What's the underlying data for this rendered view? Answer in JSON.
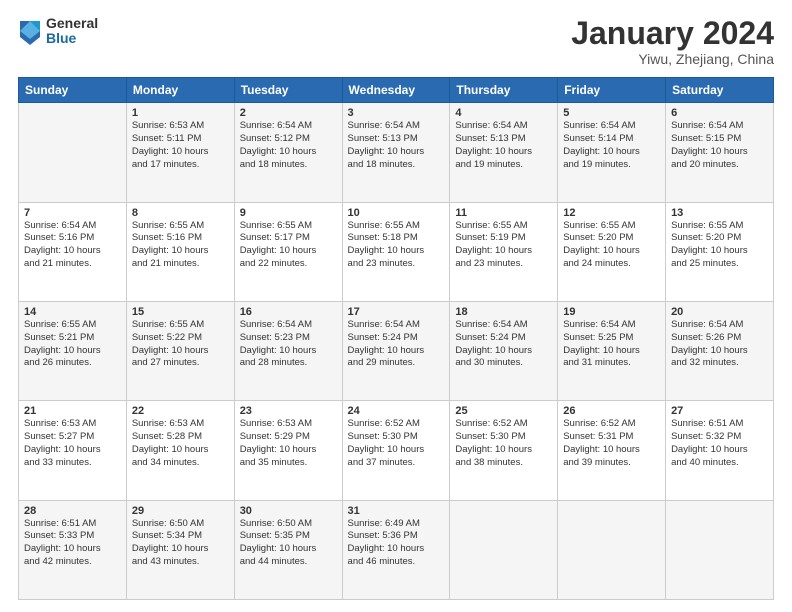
{
  "logo": {
    "general": "General",
    "blue": "Blue"
  },
  "header": {
    "month": "January 2024",
    "location": "Yiwu, Zhejiang, China"
  },
  "weekdays": [
    "Sunday",
    "Monday",
    "Tuesday",
    "Wednesday",
    "Thursday",
    "Friday",
    "Saturday"
  ],
  "weeks": [
    [
      {
        "day": "",
        "info": ""
      },
      {
        "day": "1",
        "info": "Sunrise: 6:53 AM\nSunset: 5:11 PM\nDaylight: 10 hours\nand 17 minutes."
      },
      {
        "day": "2",
        "info": "Sunrise: 6:54 AM\nSunset: 5:12 PM\nDaylight: 10 hours\nand 18 minutes."
      },
      {
        "day": "3",
        "info": "Sunrise: 6:54 AM\nSunset: 5:13 PM\nDaylight: 10 hours\nand 18 minutes."
      },
      {
        "day": "4",
        "info": "Sunrise: 6:54 AM\nSunset: 5:13 PM\nDaylight: 10 hours\nand 19 minutes."
      },
      {
        "day": "5",
        "info": "Sunrise: 6:54 AM\nSunset: 5:14 PM\nDaylight: 10 hours\nand 19 minutes."
      },
      {
        "day": "6",
        "info": "Sunrise: 6:54 AM\nSunset: 5:15 PM\nDaylight: 10 hours\nand 20 minutes."
      }
    ],
    [
      {
        "day": "7",
        "info": "Sunrise: 6:54 AM\nSunset: 5:16 PM\nDaylight: 10 hours\nand 21 minutes."
      },
      {
        "day": "8",
        "info": "Sunrise: 6:55 AM\nSunset: 5:16 PM\nDaylight: 10 hours\nand 21 minutes."
      },
      {
        "day": "9",
        "info": "Sunrise: 6:55 AM\nSunset: 5:17 PM\nDaylight: 10 hours\nand 22 minutes."
      },
      {
        "day": "10",
        "info": "Sunrise: 6:55 AM\nSunset: 5:18 PM\nDaylight: 10 hours\nand 23 minutes."
      },
      {
        "day": "11",
        "info": "Sunrise: 6:55 AM\nSunset: 5:19 PM\nDaylight: 10 hours\nand 23 minutes."
      },
      {
        "day": "12",
        "info": "Sunrise: 6:55 AM\nSunset: 5:20 PM\nDaylight: 10 hours\nand 24 minutes."
      },
      {
        "day": "13",
        "info": "Sunrise: 6:55 AM\nSunset: 5:20 PM\nDaylight: 10 hours\nand 25 minutes."
      }
    ],
    [
      {
        "day": "14",
        "info": "Sunrise: 6:55 AM\nSunset: 5:21 PM\nDaylight: 10 hours\nand 26 minutes."
      },
      {
        "day": "15",
        "info": "Sunrise: 6:55 AM\nSunset: 5:22 PM\nDaylight: 10 hours\nand 27 minutes."
      },
      {
        "day": "16",
        "info": "Sunrise: 6:54 AM\nSunset: 5:23 PM\nDaylight: 10 hours\nand 28 minutes."
      },
      {
        "day": "17",
        "info": "Sunrise: 6:54 AM\nSunset: 5:24 PM\nDaylight: 10 hours\nand 29 minutes."
      },
      {
        "day": "18",
        "info": "Sunrise: 6:54 AM\nSunset: 5:24 PM\nDaylight: 10 hours\nand 30 minutes."
      },
      {
        "day": "19",
        "info": "Sunrise: 6:54 AM\nSunset: 5:25 PM\nDaylight: 10 hours\nand 31 minutes."
      },
      {
        "day": "20",
        "info": "Sunrise: 6:54 AM\nSunset: 5:26 PM\nDaylight: 10 hours\nand 32 minutes."
      }
    ],
    [
      {
        "day": "21",
        "info": "Sunrise: 6:53 AM\nSunset: 5:27 PM\nDaylight: 10 hours\nand 33 minutes."
      },
      {
        "day": "22",
        "info": "Sunrise: 6:53 AM\nSunset: 5:28 PM\nDaylight: 10 hours\nand 34 minutes."
      },
      {
        "day": "23",
        "info": "Sunrise: 6:53 AM\nSunset: 5:29 PM\nDaylight: 10 hours\nand 35 minutes."
      },
      {
        "day": "24",
        "info": "Sunrise: 6:52 AM\nSunset: 5:30 PM\nDaylight: 10 hours\nand 37 minutes."
      },
      {
        "day": "25",
        "info": "Sunrise: 6:52 AM\nSunset: 5:30 PM\nDaylight: 10 hours\nand 38 minutes."
      },
      {
        "day": "26",
        "info": "Sunrise: 6:52 AM\nSunset: 5:31 PM\nDaylight: 10 hours\nand 39 minutes."
      },
      {
        "day": "27",
        "info": "Sunrise: 6:51 AM\nSunset: 5:32 PM\nDaylight: 10 hours\nand 40 minutes."
      }
    ],
    [
      {
        "day": "28",
        "info": "Sunrise: 6:51 AM\nSunset: 5:33 PM\nDaylight: 10 hours\nand 42 minutes."
      },
      {
        "day": "29",
        "info": "Sunrise: 6:50 AM\nSunset: 5:34 PM\nDaylight: 10 hours\nand 43 minutes."
      },
      {
        "day": "30",
        "info": "Sunrise: 6:50 AM\nSunset: 5:35 PM\nDaylight: 10 hours\nand 44 minutes."
      },
      {
        "day": "31",
        "info": "Sunrise: 6:49 AM\nSunset: 5:36 PM\nDaylight: 10 hours\nand 46 minutes."
      },
      {
        "day": "",
        "info": ""
      },
      {
        "day": "",
        "info": ""
      },
      {
        "day": "",
        "info": ""
      }
    ]
  ]
}
